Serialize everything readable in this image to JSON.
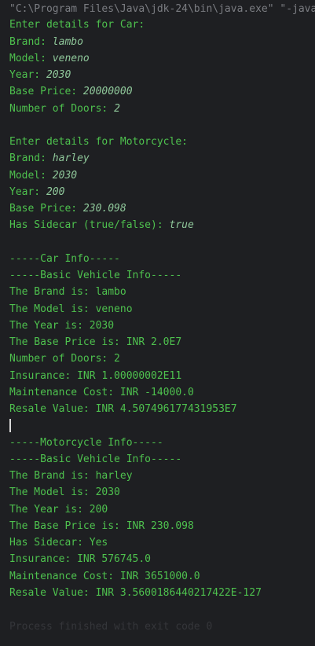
{
  "console": {
    "command_line": "\"C:\\Program Files\\Java\\jdk-24\\bin\\java.exe\" \"-javaagent:C:\\Program Files\\JetBrains\\IntelliJ IDEA",
    "car_prompt": {
      "header": "Enter details for Car:",
      "fields": [
        {
          "label": "Brand: ",
          "value": "lambo"
        },
        {
          "label": "Model: ",
          "value": "veneno"
        },
        {
          "label": "Year: ",
          "value": "2030"
        },
        {
          "label": "Base Price: ",
          "value": "20000000"
        },
        {
          "label": "Number of Doors: ",
          "value": "2"
        }
      ]
    },
    "moto_prompt": {
      "header": "Enter details for Motorcycle:",
      "fields": [
        {
          "label": "Brand: ",
          "value": "harley"
        },
        {
          "label": "Model: ",
          "value": "2030"
        },
        {
          "label": "Year: ",
          "value": "200"
        },
        {
          "label": "Base Price: ",
          "value": "230.098"
        },
        {
          "label": "Has Sidecar (true/false): ",
          "value": "true"
        }
      ]
    },
    "car_info": [
      "-----Car Info-----",
      "-----Basic Vehicle Info-----",
      "The Brand is: lambo",
      "The Model is: veneno",
      "The Year is: 2030",
      "The Base Price is: INR 2.0E7",
      "Number of Doors: 2",
      "Insurance: INR 1.00000002E11",
      "Maintenance Cost: INR -14000.0",
      "Resale Value: INR 4.507496177431953E7"
    ],
    "moto_info": [
      "-----Motorcycle Info-----",
      "-----Basic Vehicle Info-----",
      "The Brand is: harley",
      "The Model is: 2030",
      "The Year is: 200",
      "The Base Price is: INR 230.098",
      "Has Sidecar: Yes",
      "Insurance: INR 576745.0",
      "Maintenance Cost: INR 3651000.0",
      "Resale Value: INR 3.5600186440217422E-127"
    ],
    "exit_message": "Process finished with exit code 0"
  }
}
